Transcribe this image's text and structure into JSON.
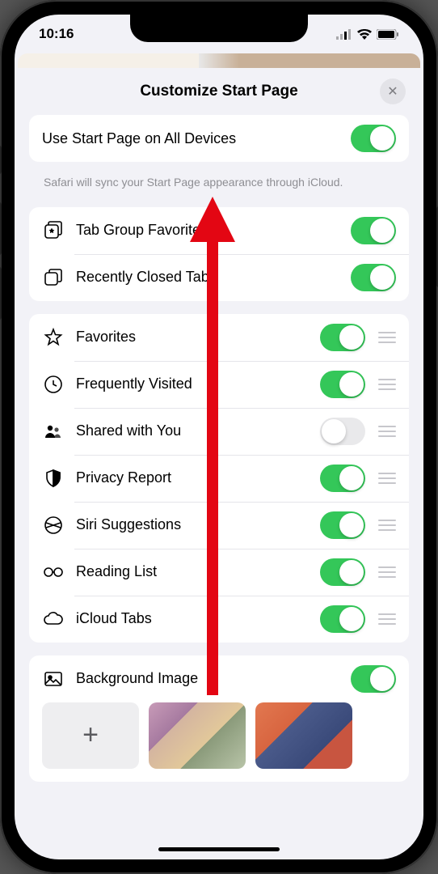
{
  "status": {
    "time": "10:16"
  },
  "sheet": {
    "title": "Customize Start Page",
    "close_label": "✕"
  },
  "sync": {
    "label": "Use Start Page on All Devices",
    "enabled": true,
    "footer": "Safari will sync your Start Page appearance through iCloud."
  },
  "group_tabs": [
    {
      "icon": "tab-group-favorites-icon",
      "label": "Tab Group Favorites",
      "enabled": true
    },
    {
      "icon": "recently-closed-icon",
      "label": "Recently Closed Tabs",
      "enabled": true
    }
  ],
  "reorder_items": [
    {
      "icon": "star-icon",
      "label": "Favorites",
      "enabled": true
    },
    {
      "icon": "clock-icon",
      "label": "Frequently Visited",
      "enabled": true
    },
    {
      "icon": "shared-icon",
      "label": "Shared with You",
      "enabled": false
    },
    {
      "icon": "shield-icon",
      "label": "Privacy Report",
      "enabled": true
    },
    {
      "icon": "siri-icon",
      "label": "Siri Suggestions",
      "enabled": true
    },
    {
      "icon": "glasses-icon",
      "label": "Reading List",
      "enabled": true
    },
    {
      "icon": "cloud-icon",
      "label": "iCloud Tabs",
      "enabled": true
    }
  ],
  "background": {
    "label": "Background Image",
    "enabled": true,
    "add_label": "+"
  }
}
